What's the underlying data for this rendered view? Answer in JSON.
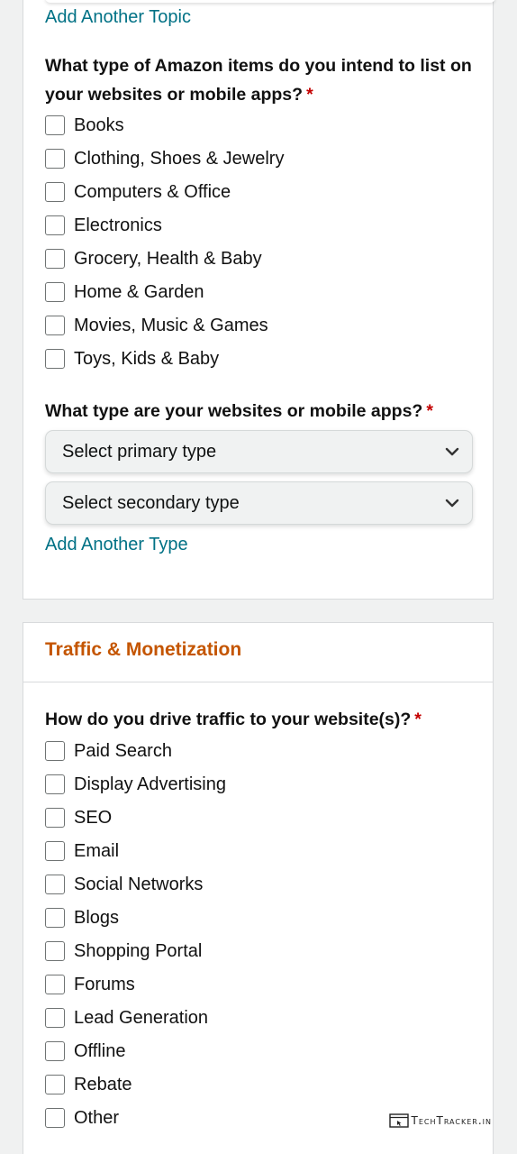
{
  "top_card": {
    "add_topic_link": "Add Another Topic",
    "items_question": "What type of Amazon items do you intend to list on your websites or mobile apps?",
    "required_marker": "*",
    "item_options": [
      "Books",
      "Clothing, Shoes & Jewelry",
      "Computers & Office",
      "Electronics",
      "Grocery, Health & Baby",
      "Home & Garden",
      "Movies, Music & Games",
      "Toys, Kids & Baby"
    ],
    "type_question": "What type are your websites or mobile apps?",
    "primary_select": "Select primary type",
    "secondary_select": "Select secondary type",
    "add_type_link": "Add Another Type"
  },
  "traffic_card": {
    "title": "Traffic & Monetization",
    "traffic_question": "How do you drive traffic to your website(s)?",
    "required_marker": "*",
    "traffic_options": [
      "Paid Search",
      "Display Advertising",
      "SEO",
      "Email",
      "Social Networks",
      "Blogs",
      "Shopping Portal",
      "Forums",
      "Lead Generation",
      "Offline",
      "Rebate",
      "Other"
    ]
  },
  "watermark": {
    "text": "TechTracker.in",
    "icon": "browser-window-icon"
  },
  "colors": {
    "link": "#007185",
    "required": "#c40000",
    "section_title": "#c45500",
    "background": "#f0f1f1"
  }
}
